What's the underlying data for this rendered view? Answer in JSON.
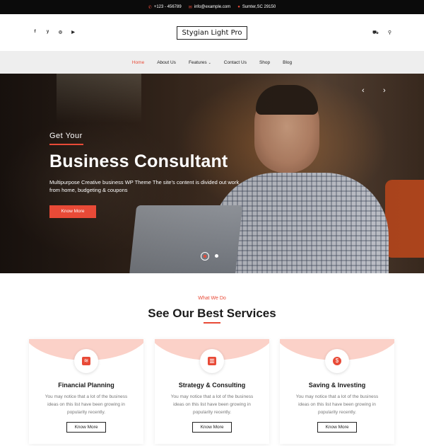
{
  "topbar": {
    "phone": "+123 - 456789",
    "email": "info@example.com",
    "location": "Sumter,SC 29150"
  },
  "header": {
    "logo": "Stygian Light Pro",
    "social": [
      "f",
      "y",
      "◎",
      "▶"
    ]
  },
  "nav": {
    "items": [
      "Home",
      "About Us",
      "Features",
      "Contact Us",
      "Shop",
      "Blog"
    ],
    "active": "Home"
  },
  "hero": {
    "eyebrow": "Get Your",
    "title": "Business Consultant",
    "description": "Multipurpose Creative business WP Theme The site's content is divided out work from home, budgeting & coupons",
    "button": "Know More",
    "slide_count": 2,
    "active_slide": 1
  },
  "services": {
    "eyebrow": "What We Do",
    "title": "See Our Best Services",
    "cards": [
      {
        "icon": "layers-icon",
        "glyph": "≋",
        "title": "Financial Planning",
        "description": "You may notice that a lot of the business ideas on this list have been growing in popularity recently.",
        "button": "Know More"
      },
      {
        "icon": "chart-icon",
        "glyph": "▥",
        "title": "Strategy & Consulting",
        "description": "You may notice that a lot of the business ideas on this list have been growing in popularity recently.",
        "button": "Know More"
      },
      {
        "icon": "dollar-icon",
        "glyph": "$",
        "title": "Saving & Investing",
        "description": "You may notice that a lot of the business ideas on this list have been growing in popularity recently.",
        "button": "Know More"
      }
    ]
  },
  "colors": {
    "accent": "#e84a37",
    "topbar_bg": "#0b0b0b",
    "nav_bg": "#eeeeee",
    "card_arc": "#fbd1c8"
  }
}
